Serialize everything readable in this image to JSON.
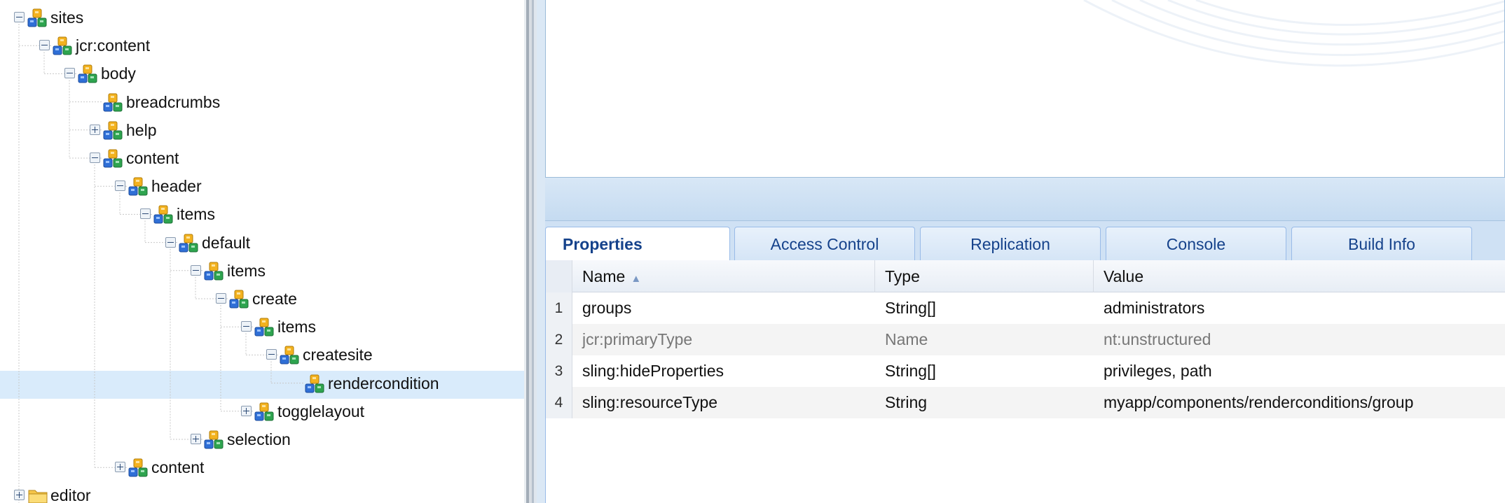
{
  "tree": {
    "nodes": [
      {
        "label": "sites",
        "icon": "node-icon",
        "toggle": "minus"
      },
      {
        "label": "jcr:content",
        "icon": "node-icon",
        "toggle": "minus"
      },
      {
        "label": "body",
        "icon": "node-icon",
        "toggle": "minus"
      },
      {
        "label": "breadcrumbs",
        "icon": "node-icon",
        "toggle": "none"
      },
      {
        "label": "help",
        "icon": "node-icon",
        "toggle": "plus"
      },
      {
        "label": "content",
        "icon": "node-icon",
        "toggle": "minus"
      },
      {
        "label": "header",
        "icon": "node-icon",
        "toggle": "minus"
      },
      {
        "label": "items",
        "icon": "node-icon",
        "toggle": "minus"
      },
      {
        "label": "default",
        "icon": "node-icon",
        "toggle": "minus"
      },
      {
        "label": "items",
        "icon": "node-icon",
        "toggle": "minus"
      },
      {
        "label": "create",
        "icon": "node-icon",
        "toggle": "minus"
      },
      {
        "label": "items",
        "icon": "node-icon",
        "toggle": "minus"
      },
      {
        "label": "createsite",
        "icon": "node-icon",
        "toggle": "minus"
      },
      {
        "label": "rendercondition",
        "icon": "node-icon",
        "toggle": "none",
        "selected": true
      },
      {
        "label": "togglelayout",
        "icon": "node-icon",
        "toggle": "plus"
      },
      {
        "label": "selection",
        "icon": "node-icon",
        "toggle": "plus"
      },
      {
        "label": "content",
        "icon": "node-icon",
        "toggle": "plus"
      },
      {
        "label": "editor",
        "icon": "folder-icon",
        "toggle": "plus"
      }
    ]
  },
  "tabs": [
    "Properties",
    "Access Control",
    "Replication",
    "Console",
    "Build Info"
  ],
  "active_tab": "Properties",
  "grid": {
    "columns": [
      "Name",
      "Type",
      "Value"
    ],
    "sort_column": "Name",
    "sort_icon": "sort-ascending-icon",
    "rows": [
      {
        "n": "1",
        "name": "groups",
        "type": "String[]",
        "value": "administrators",
        "muted": false
      },
      {
        "n": "2",
        "name": "jcr:primaryType",
        "type": "Name",
        "value": "nt:unstructured",
        "muted": true
      },
      {
        "n": "3",
        "name": "sling:hideProperties",
        "type": "String[]",
        "value": "privileges, path",
        "muted": false
      },
      {
        "n": "4",
        "name": "sling:resourceType",
        "type": "String",
        "value": "myapp/components/renderconditions/group",
        "muted": false
      }
    ]
  },
  "colors": {
    "selection": "#d9ebfb",
    "tab_text": "#15428b",
    "panel_bg": "#dbe8f5"
  }
}
